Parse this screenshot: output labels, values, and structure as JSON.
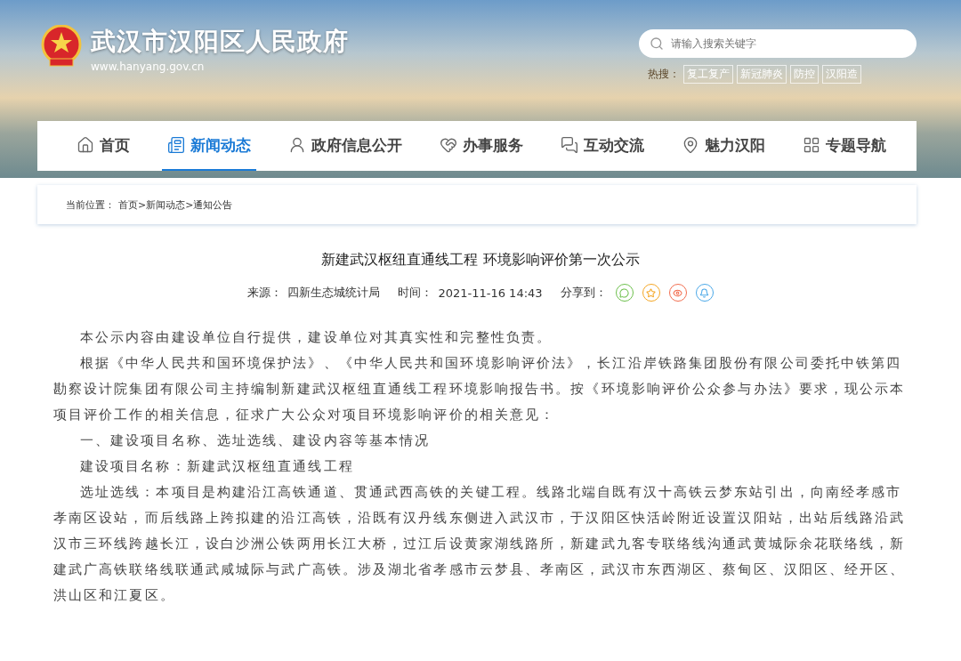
{
  "header": {
    "site_title": "武汉市汉阳区人民政府",
    "site_url": "www.hanyang.gov.cn",
    "search": {
      "placeholder": "请输入搜索关键字"
    },
    "hot_label": "热搜：",
    "hot_tags": [
      "复工复产",
      "新冠肺炎",
      "防控",
      "汉阳造"
    ]
  },
  "nav": [
    {
      "label": "首页",
      "selected": false
    },
    {
      "label": "新闻动态",
      "selected": true
    },
    {
      "label": "政府信息公开",
      "selected": false
    },
    {
      "label": "办事服务",
      "selected": false
    },
    {
      "label": "互动交流",
      "selected": false
    },
    {
      "label": "魅力汉阳",
      "selected": false
    },
    {
      "label": "专题导航",
      "selected": false
    }
  ],
  "breadcrumb": {
    "label": "当前位置：",
    "path": "首页>新闻动态>通知公告"
  },
  "article": {
    "title": "新建武汉枢纽直通线工程 环境影响评价第一次公示",
    "source_label": "来源：",
    "source": "四新生态城统计局",
    "time_label": "时间：",
    "time": "2021-11-16 14:43",
    "share_label": "分享到：",
    "share": [
      {
        "kind": "wechat",
        "color": "#6cbf4b"
      },
      {
        "kind": "star",
        "color": "#f5a623"
      },
      {
        "kind": "weibo",
        "color": "#f26d4f"
      },
      {
        "kind": "qq",
        "color": "#4aa8e8"
      }
    ],
    "paragraphs": [
      "本公示内容由建设单位自行提供，建设单位对其真实性和完整性负责。",
      "根据《中华人民共和国环境保护法》、《中华人民共和国环境影响评价法》，长江沿岸铁路集团股份有限公司委托中铁第四勘察设计院集团有限公司主持编制新建武汉枢纽直通线工程环境影响报告书。按《环境影响评价公众参与办法》要求，现公示本项目评价工作的相关信息，征求广大公众对项目环境影响评价的相关意见：",
      "一、建设项目名称、选址选线、建设内容等基本情况",
      "建设项目名称：新建武汉枢纽直通线工程",
      "选址选线：本项目是构建沿江高铁通道、贯通武西高铁的关键工程。线路北端自既有汉十高铁云梦东站引出，向南经孝感市孝南区设站，而后线路上跨拟建的沿江高铁，沿既有汉丹线东侧进入武汉市，于汉阳区快活岭附近设置汉阳站，出站后线路沿武汉市三环线跨越长江，设白沙洲公铁两用长江大桥，过江后设黄家湖线路所，新建武九客专联络线沟通武黄城际余花联络线，新建武广高铁联络线联通武咸城际与武广高铁。涉及湖北省孝感市云梦县、孝南区，武汉市东西湖区、蔡甸区、汉阳区、经开区、洪山区和江夏区。"
    ]
  }
}
